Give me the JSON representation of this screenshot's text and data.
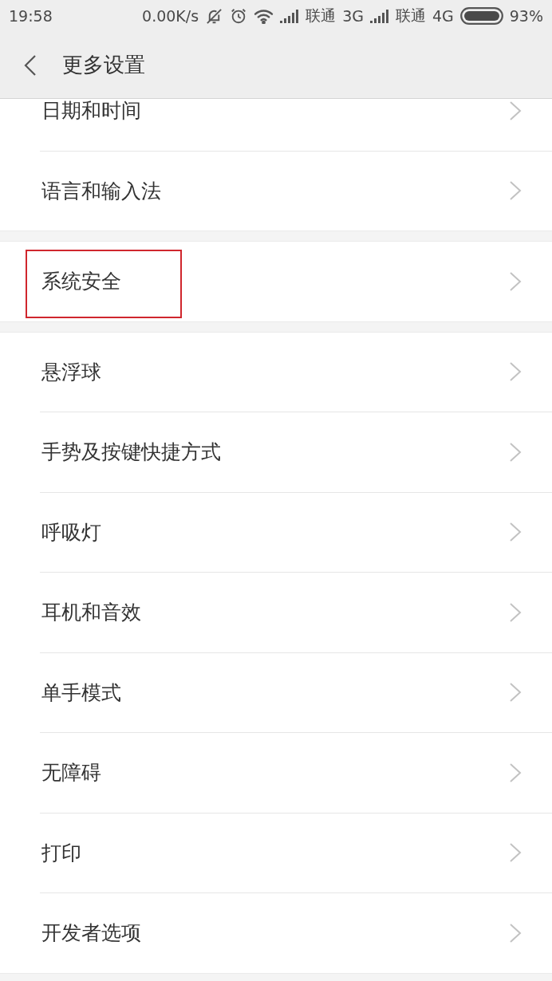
{
  "status_bar": {
    "time": "19:58",
    "net_speed": "0.00K/s",
    "sims": [
      {
        "carrier": "联通",
        "network": "3G"
      },
      {
        "carrier": "联通",
        "network": "4G"
      }
    ],
    "battery": "93%"
  },
  "header": {
    "title": "更多设置"
  },
  "groups": [
    {
      "items": [
        {
          "label": "日期和时间",
          "highlighted": false
        },
        {
          "label": "语言和输入法",
          "highlighted": false
        }
      ]
    },
    {
      "items": [
        {
          "label": "系统安全",
          "highlighted": true
        }
      ]
    },
    {
      "items": [
        {
          "label": "悬浮球",
          "highlighted": false
        },
        {
          "label": "手势及按键快捷方式",
          "highlighted": false
        },
        {
          "label": "呼吸灯",
          "highlighted": false
        },
        {
          "label": "耳机和音效",
          "highlighted": false
        },
        {
          "label": "单手模式",
          "highlighted": false
        },
        {
          "label": "无障碍",
          "highlighted": false
        },
        {
          "label": "打印",
          "highlighted": false
        },
        {
          "label": "开发者选项",
          "highlighted": false
        }
      ]
    }
  ]
}
